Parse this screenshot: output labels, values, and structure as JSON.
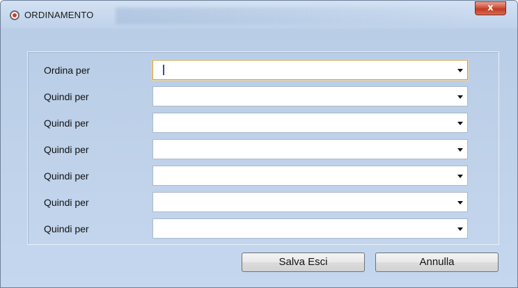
{
  "window": {
    "title": "ORDINAMENTO",
    "close_glyph": "x",
    "icon": "radio-record-icon"
  },
  "sort_rows": [
    {
      "label": "Ordina per",
      "value": ""
    },
    {
      "label": "Quindi per",
      "value": ""
    },
    {
      "label": "Quindi per",
      "value": ""
    },
    {
      "label": "Quindi per",
      "value": ""
    },
    {
      "label": "Quindi per",
      "value": ""
    },
    {
      "label": "Quindi per",
      "value": ""
    },
    {
      "label": "Quindi per",
      "value": ""
    }
  ],
  "buttons": {
    "save_exit_label": "Salva Esci",
    "cancel_label": "Annulla"
  },
  "colors": {
    "window_background": "#c5d7ee",
    "close_button": "#c23b22"
  }
}
